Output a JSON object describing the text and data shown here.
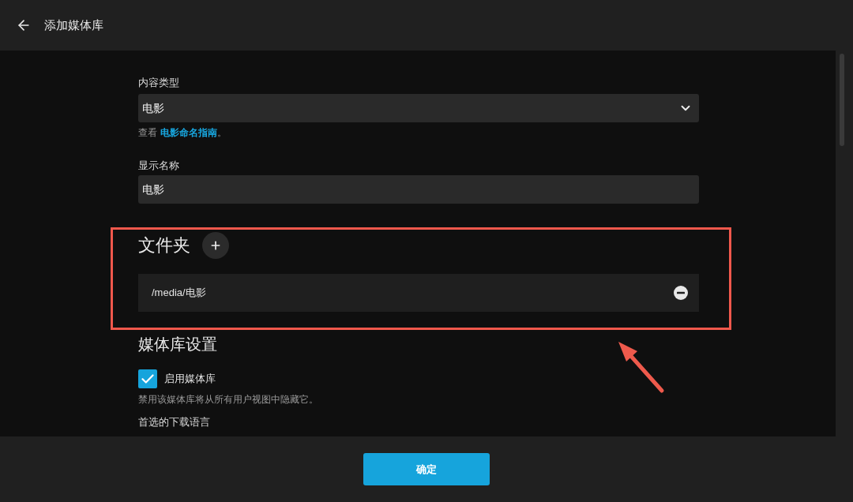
{
  "header": {
    "title": "添加媒体库"
  },
  "content_type": {
    "label": "内容类型",
    "value": "电影",
    "hint": {
      "prefix": "查看",
      "link": "电影命名指南",
      "suffix": "。"
    }
  },
  "display_name": {
    "label": "显示名称",
    "value": "电影"
  },
  "folders": {
    "title": "文件夹",
    "items": [
      {
        "path": "/media/电影"
      }
    ]
  },
  "library_settings": {
    "title": "媒体库设置",
    "enable": {
      "label": "启用媒体库",
      "checked": true,
      "description": "禁用该媒体库将从所有用户视图中隐藏它。"
    },
    "next_label": "首选的下载语言"
  },
  "footer": {
    "button": "确定"
  }
}
